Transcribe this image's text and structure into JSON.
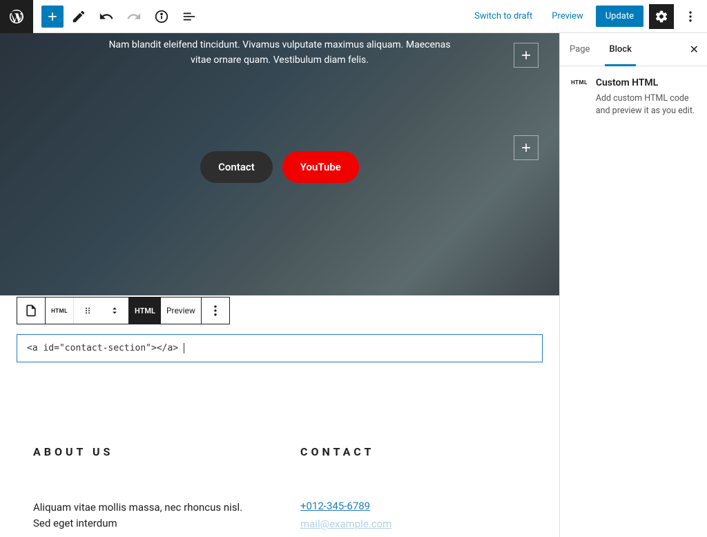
{
  "toolbar": {
    "switch_to_draft": "Switch to draft",
    "preview": "Preview",
    "update": "Update"
  },
  "hero": {
    "text_line1": "Nam blandit eleifend tincidunt. Vivamus vulputate maximus aliquam. Maecenas",
    "text_line2": "vitae ornare quam. Vestibulum diam felis.",
    "contact_label": "Contact",
    "youtube_label": "YouTube"
  },
  "block_toolbar": {
    "html_icon": "HTML",
    "html_tab": "HTML",
    "preview_tab": "Preview"
  },
  "code": "<a id=\"contact-section\"></a>",
  "lower": {
    "about_heading": "ABOUT US",
    "about_text": "Aliquam vitae mollis massa, nec rhoncus nisl. Sed eget interdum",
    "contact_heading": "CONTACT",
    "phone": "+012-345-6789",
    "email": "mail@example.com"
  },
  "sidebar": {
    "tab_page": "Page",
    "tab_block": "Block",
    "icon_label": "HTML",
    "block_title": "Custom HTML",
    "block_desc": "Add custom HTML code and preview it as you edit."
  }
}
